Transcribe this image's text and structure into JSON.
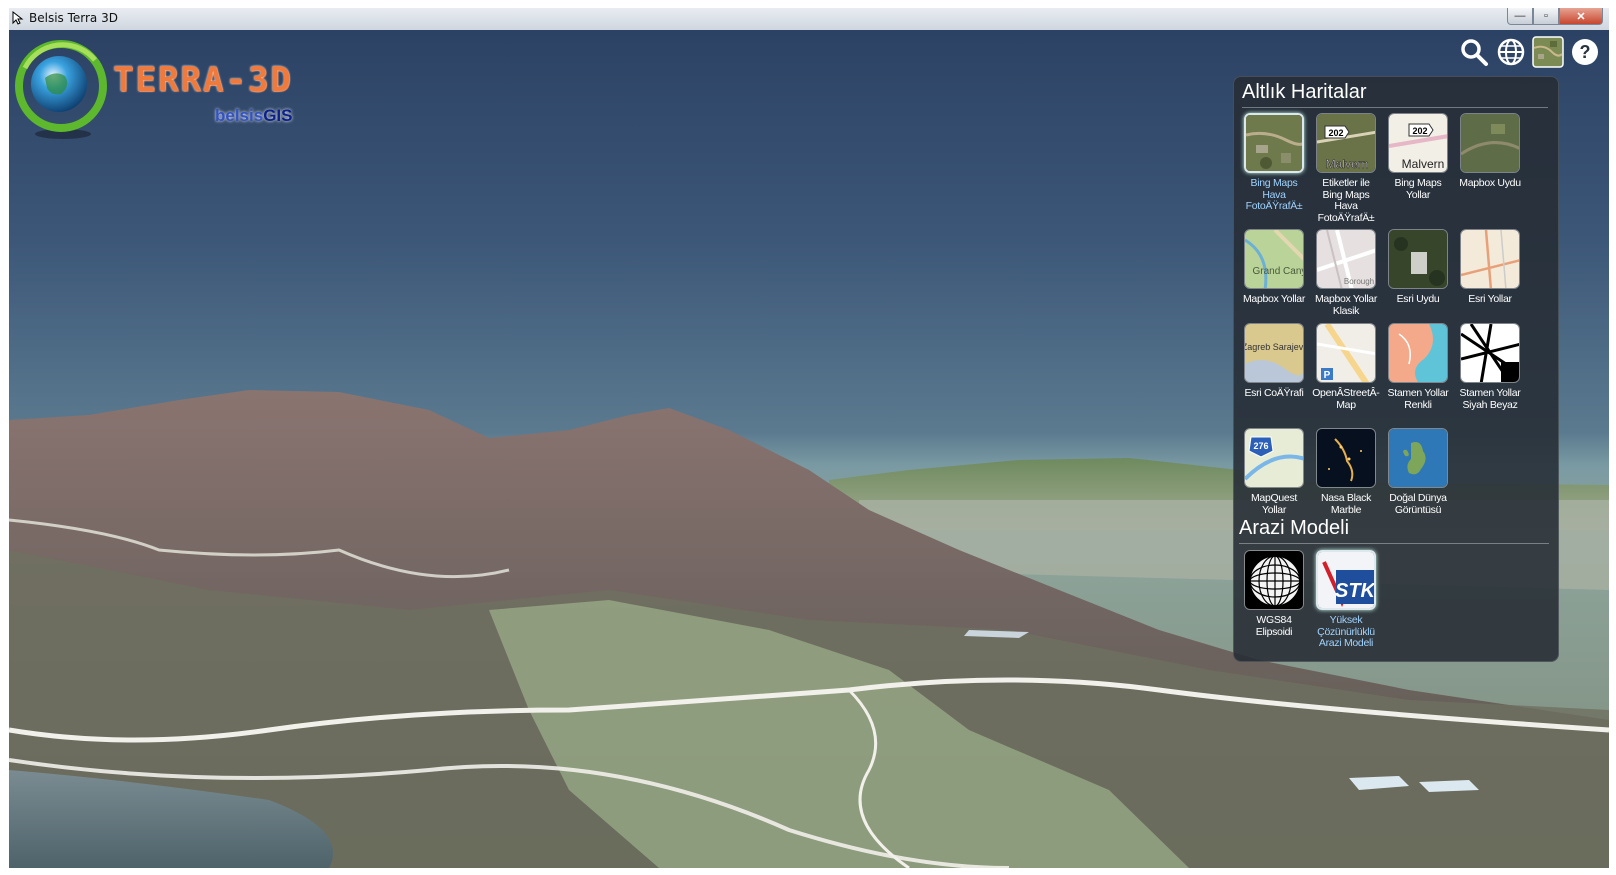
{
  "window": {
    "title": "Belsis Terra 3D",
    "controls": {
      "minimize": "—",
      "maximize": "▫",
      "close": "✕"
    }
  },
  "logo": {
    "title": "TERRA-3D",
    "sub_prefix": "belsis",
    "sub_suffix": "GIS"
  },
  "toolbar": {
    "icons": [
      "search-icon",
      "globe-icon",
      "basemap-icon",
      "help-icon"
    ],
    "help_glyph": "?"
  },
  "basemaps": {
    "title": "Altlık Haritalar",
    "items": [
      {
        "label": "Bing Maps Hava FotoÄŸrafÄ±",
        "selected": true
      },
      {
        "label": "Etiketler ile Bing Maps Hava FotoÄŸrafÄ±",
        "badge": "202",
        "text": "Malvern"
      },
      {
        "label": "Bing Maps Yollar",
        "badge": "202",
        "text": "Malvern"
      },
      {
        "label": "Mapbox Uydu"
      },
      {
        "label": "Mapbox Yollar",
        "text": "Grand Canyon"
      },
      {
        "label": "Mapbox Yollar Klasik",
        "text": "Borough"
      },
      {
        "label": "Esri Uydu"
      },
      {
        "label": "Esri Yollar"
      },
      {
        "label": "Esri CoÄŸrafi",
        "text": "Zagreb Sarajevo"
      },
      {
        "label": "OpenÂ­StreetÂ­Map"
      },
      {
        "label": "Stamen Yollar Renkli"
      },
      {
        "label": "Stamen Yollar Siyah Beyaz"
      },
      {
        "label": "MapQuest Yollar",
        "badge": "276"
      },
      {
        "label": "Nasa Black Marble"
      },
      {
        "label": "Doğal Dünya Görüntüsü"
      }
    ]
  },
  "terrain": {
    "title": "Arazi Modeli",
    "items": [
      {
        "label": "WGS84 Elipsoidi"
      },
      {
        "label": "Yüksek Çözünürlüklü Arazi Modeli",
        "selected": true,
        "text": "STK"
      }
    ]
  },
  "colors": {
    "panel_bg": "#262c34",
    "selected_caption": "#9fd3ff",
    "logo_orange": "#f07a3c"
  }
}
